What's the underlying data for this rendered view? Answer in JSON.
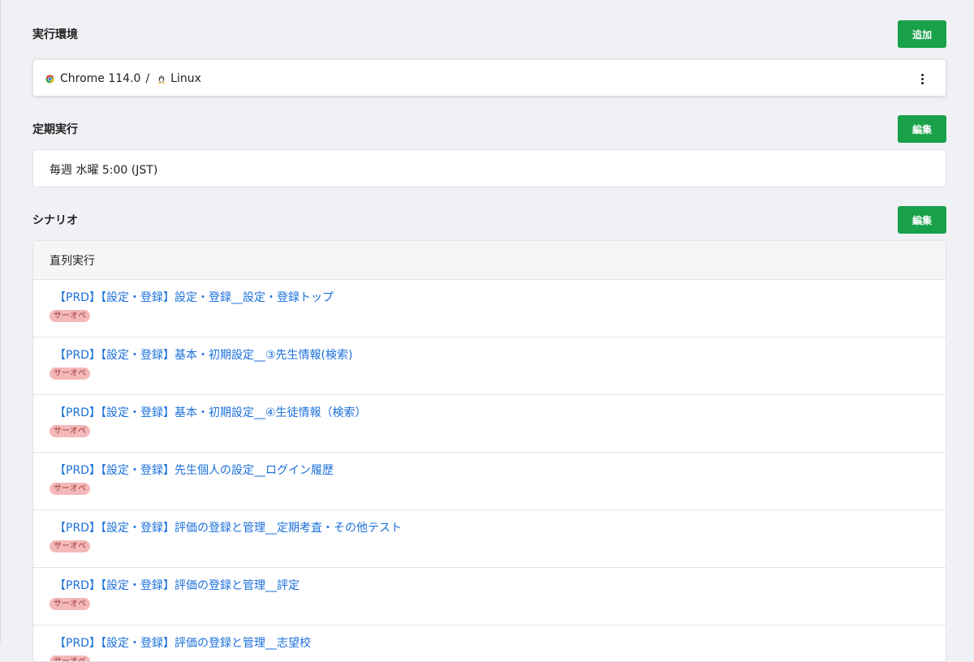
{
  "env": {
    "title": "実行環境",
    "add_label": "追加",
    "browser": "Chrome 114.0",
    "separator": "/",
    "os": "Linux"
  },
  "schedule": {
    "title": "定期実行",
    "edit_label": "編集",
    "value": "毎週 水曜 5:00 (JST)"
  },
  "scenario": {
    "title": "シナリオ",
    "edit_label": "編集",
    "mode": "直列実行",
    "items": [
      {
        "title": "【PRD】【設定・登録】設定・登録__設定・登録トップ",
        "tag": "サーオペ"
      },
      {
        "title": "【PRD】【設定・登録】基本・初期設定__③先生情報(検索)",
        "tag": "サーオペ"
      },
      {
        "title": "【PRD】【設定・登録】基本・初期設定__④生徒情報（検索）",
        "tag": "サーオペ"
      },
      {
        "title": "【PRD】【設定・登録】先生個人の設定__ログイン履歴",
        "tag": "サーオペ"
      },
      {
        "title": "【PRD】【設定・登録】評価の登録と管理__定期考査・その他テスト",
        "tag": "サーオペ"
      },
      {
        "title": "【PRD】【設定・登録】評価の登録と管理__評定",
        "tag": "サーオペ"
      },
      {
        "title": "【PRD】【設定・登録】評価の登録と管理__志望校",
        "tag": "サーオペ"
      }
    ]
  },
  "colors": {
    "button": "#19a14a",
    "link": "#1a6fdb",
    "badge_bg": "#f4b8b8",
    "badge_text": "#9c3b3b",
    "page_bg": "#f0f1f5"
  }
}
